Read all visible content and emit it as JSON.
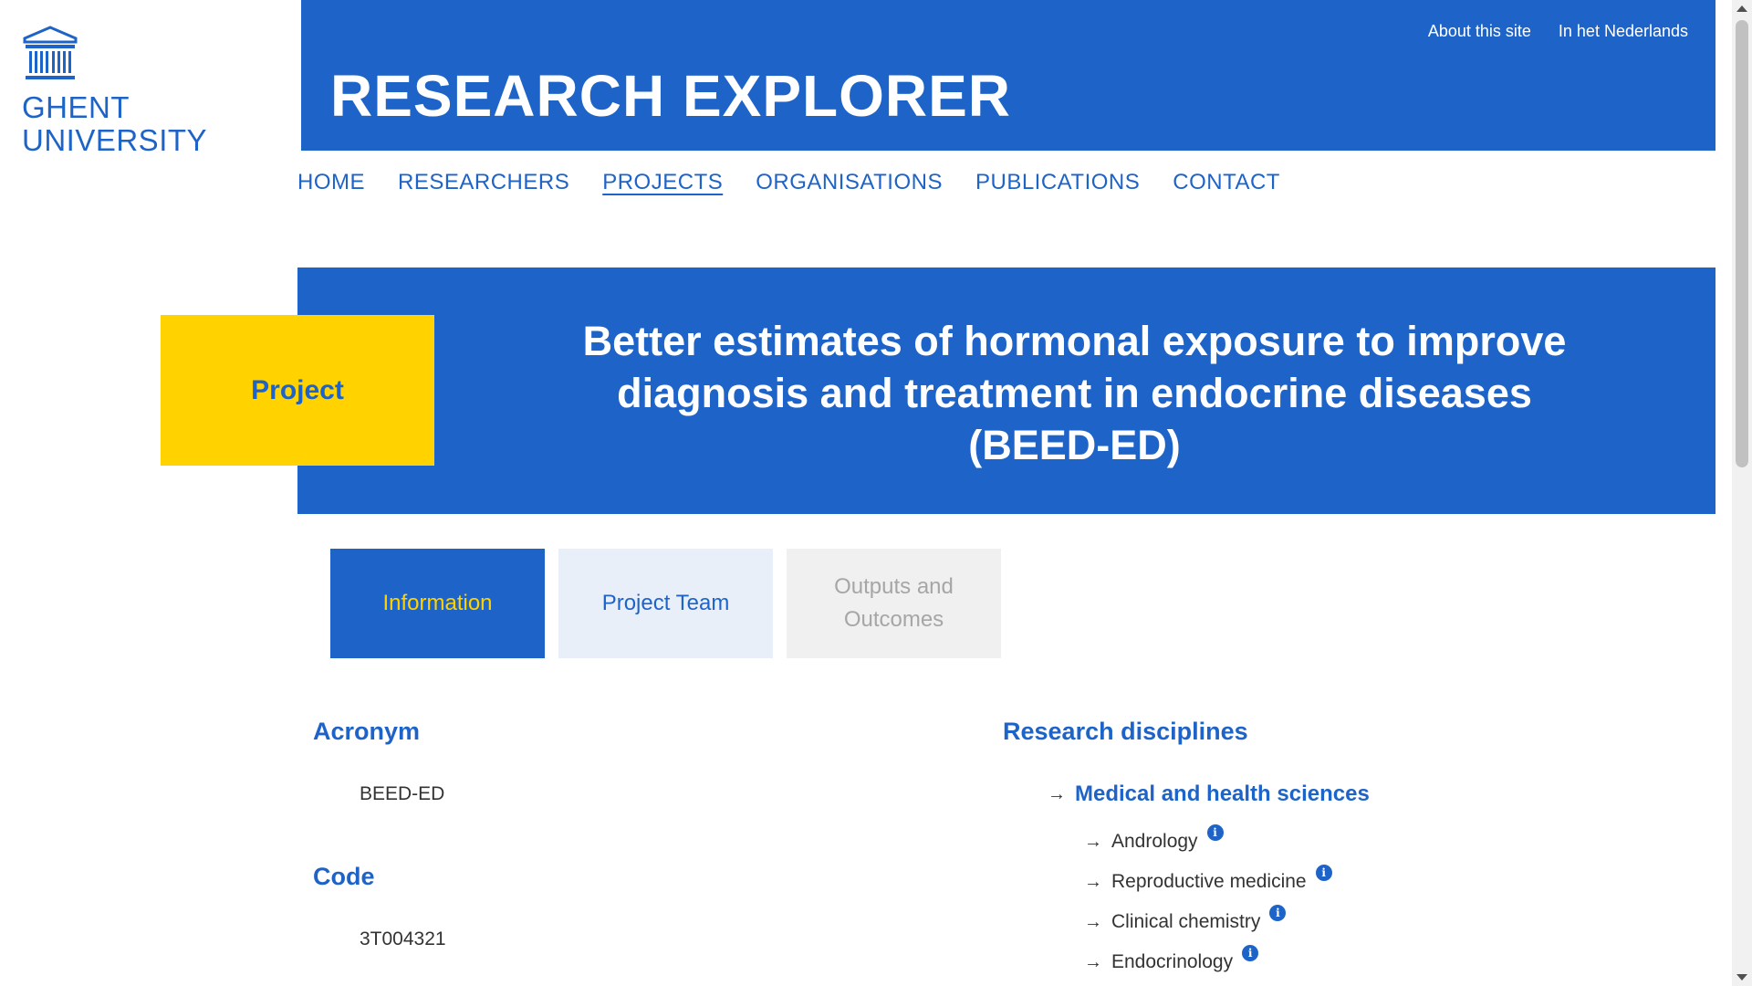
{
  "brand": {
    "logo_icon": "university-building-icon",
    "logo_line1": "GHENT",
    "logo_line2": "UNIVERSITY",
    "site_title": "RESEARCH EXPLORER",
    "colors": {
      "primary": "#1e64c8",
      "accent": "#ffd200"
    }
  },
  "toplinks": {
    "about": "About this site",
    "language": "In het Nederlands"
  },
  "nav": {
    "home": "HOME",
    "researchers": "RESEARCHERS",
    "projects": "PROJECTS",
    "organisations": "ORGANISATIONS",
    "publications": "PUBLICATIONS",
    "contact": "CONTACT",
    "active": "PROJECTS"
  },
  "hero": {
    "type_label": "Project",
    "title": "Better estimates of hormonal exposure to improve diagnosis and treatment in endocrine diseases (BEED-ED)"
  },
  "tabs": {
    "information": "Information",
    "team": "Project Team",
    "outputs": "Outputs and Outcomes"
  },
  "info": {
    "acronym_heading": "Acronym",
    "acronym_value": "BEED-ED",
    "code_heading": "Code",
    "code_value": "3T004321"
  },
  "disciplines": {
    "heading": "Research disciplines",
    "top": "Medical and health sciences",
    "items": [
      "Andrology",
      "Reproductive medicine",
      "Clinical chemistry",
      "Endocrinology"
    ]
  }
}
